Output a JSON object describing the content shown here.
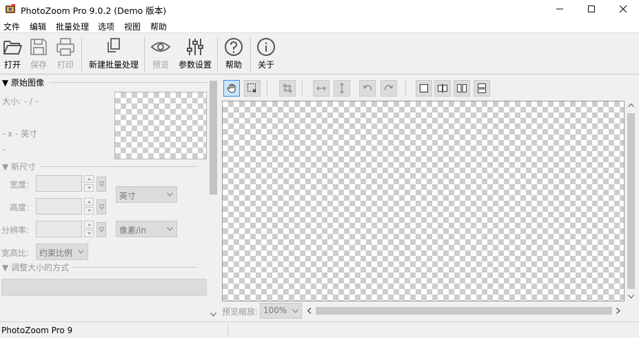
{
  "window": {
    "title": "PhotoZoom Pro 9.0.2 (Demo 版本)"
  },
  "menu": {
    "items": [
      "文件",
      "编辑",
      "批量处理",
      "选项",
      "视图",
      "帮助"
    ]
  },
  "toolbar": {
    "open": "打开",
    "save": "保存",
    "print": "打印",
    "new_batch": "新建批量处理",
    "preview": "预览",
    "settings": "参数设置",
    "help": "帮助",
    "about": "关于"
  },
  "left_panel": {
    "original_header": "▼ 原始图像",
    "size_text": "大小: - / -",
    "dims_text": "- x - 英寸",
    "dash_text": "-",
    "new_size_header": "▼ 新尺寸",
    "width_label": "宽度:",
    "height_label": "高度:",
    "resolution_label": "分辨率:",
    "unit_select": "英寸",
    "res_unit_select": "像素/in",
    "aspect_label": "宽高比:",
    "aspect_select": "约束比例",
    "resize_method_header": "▼ 调整大小的方式"
  },
  "preview": {
    "zoom_label": "预览缩放:",
    "zoom_value": "100%"
  },
  "status": {
    "text": "PhotoZoom Pro 9"
  },
  "colors": {
    "active_tool_bg": "#cce4f7",
    "active_tool_border": "#3c8dde",
    "panel_bg": "#f0f0f0"
  }
}
